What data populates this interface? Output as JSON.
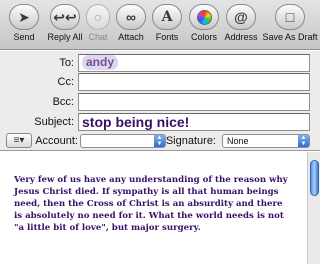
{
  "toolbar": {
    "send": "Send",
    "reply_all": "Reply All",
    "chat": "Chat",
    "attach": "Attach",
    "fonts": "Fonts",
    "colors": "Colors",
    "address": "Address",
    "save_as_draft": "Save As Draft",
    "send_icon": "paper-plane-icon",
    "reply_all_icon": "reply-all-icon",
    "chat_icon": "chat-bubble-icon",
    "attach_icon": "paperclip-icon",
    "fonts_icon": "font-icon",
    "colors_icon": "color-wheel-icon",
    "address_icon": "address-book-icon",
    "save_icon": "draft-icon"
  },
  "headers": {
    "to_label": "To:",
    "to_value": "andy",
    "cc_label": "Cc:",
    "cc_value": "",
    "bcc_label": "Bcc:",
    "bcc_value": "",
    "subject_label": "Subject:",
    "subject_value": "stop being nice!",
    "account_label": "Account:",
    "account_value": "",
    "signature_label": "Signature:",
    "signature_value": "None"
  },
  "body": {
    "text": "Very few of us have any understanding of the reason why Jesus Christ died. If sympathy is all that human beings need, then the Cross of Christ is an absurdity and there is absolutely no need for it. What the world needs is not \"a little bit of love\", but major surgery."
  },
  "colors": {
    "body_text": "#3a0f66",
    "subject_text": "#3a0f66",
    "recipient_token_bg": "#dcd8f0",
    "scroll_thumb": "#5f95e6"
  }
}
